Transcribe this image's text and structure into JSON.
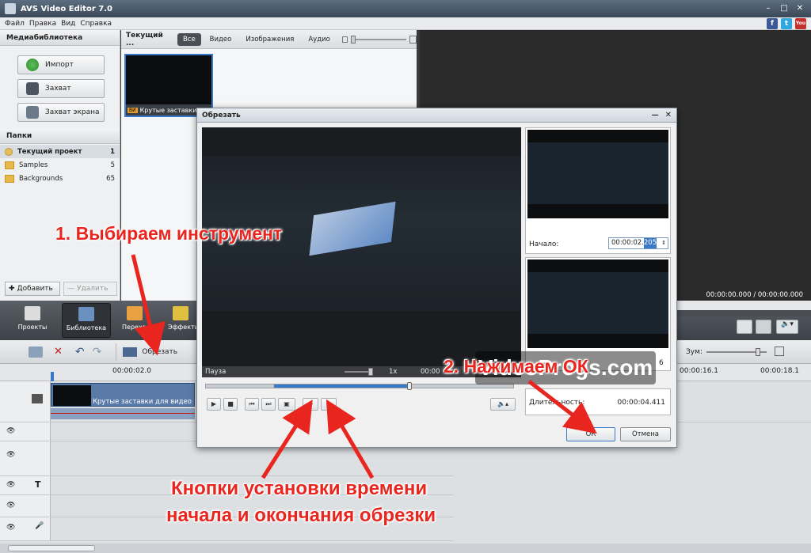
{
  "window": {
    "title": "AVS Video Editor 7.0"
  },
  "menu": [
    "Файл",
    "Правка",
    "Вид",
    "Справка"
  ],
  "social": [
    "f",
    "t",
    "You"
  ],
  "media_library": {
    "header": "Медиабиблиотека",
    "buttons": [
      "Импорт",
      "Захват",
      "Захват экрана"
    ],
    "folders_header": "Папки",
    "folders": [
      {
        "name": "Текущий проект",
        "count": "1"
      },
      {
        "name": "Samples",
        "count": "5"
      },
      {
        "name": "Backgrounds",
        "count": "65"
      }
    ],
    "add_label": "Добавить",
    "delete_label": "Удалить"
  },
  "media_area": {
    "project_tab": "Текущий ...",
    "filters": [
      "Все",
      "Видео",
      "Изображения",
      "Аудио"
    ],
    "clip_name": "Крутые заставки"
  },
  "preview": {
    "time": "00:00:00.000 / 00:00:00.000"
  },
  "big_toolbar": [
    "Проекты",
    "Библиотека",
    "Переходы",
    "Эффекты"
  ],
  "timeline_toolbar": {
    "trim_label": "Обрезать",
    "zoom_label": "Зум:"
  },
  "ruler": [
    "00:00:02.0",
    "00:00:16.1",
    "00:00:18.1"
  ],
  "timeline_clip": "Крутые заставки для видео",
  "dialog": {
    "title": "Обрезать",
    "status": "Пауза",
    "speed": "1x",
    "time_partial": "00:00",
    "end_partial": "6",
    "start_label": "Начало:",
    "start_value": "00:00:02.",
    "start_ms": "205",
    "duration_label": "Длительность:",
    "duration_value": "00:00:04.411",
    "ok_label": "ОК",
    "cancel_label": "Отмена"
  },
  "annotations": {
    "step1": "1. Выбираем инструмент",
    "step2": "2. Нажимаем ОК",
    "buttons_note_line1": "Кнопки установки времени",
    "buttons_note_line2": "начала и окончания обрезки"
  },
  "watermark": "VideoProgs.com",
  "colors": {
    "annotation_red": "#e8261f",
    "selection_blue": "#3a78c8"
  }
}
